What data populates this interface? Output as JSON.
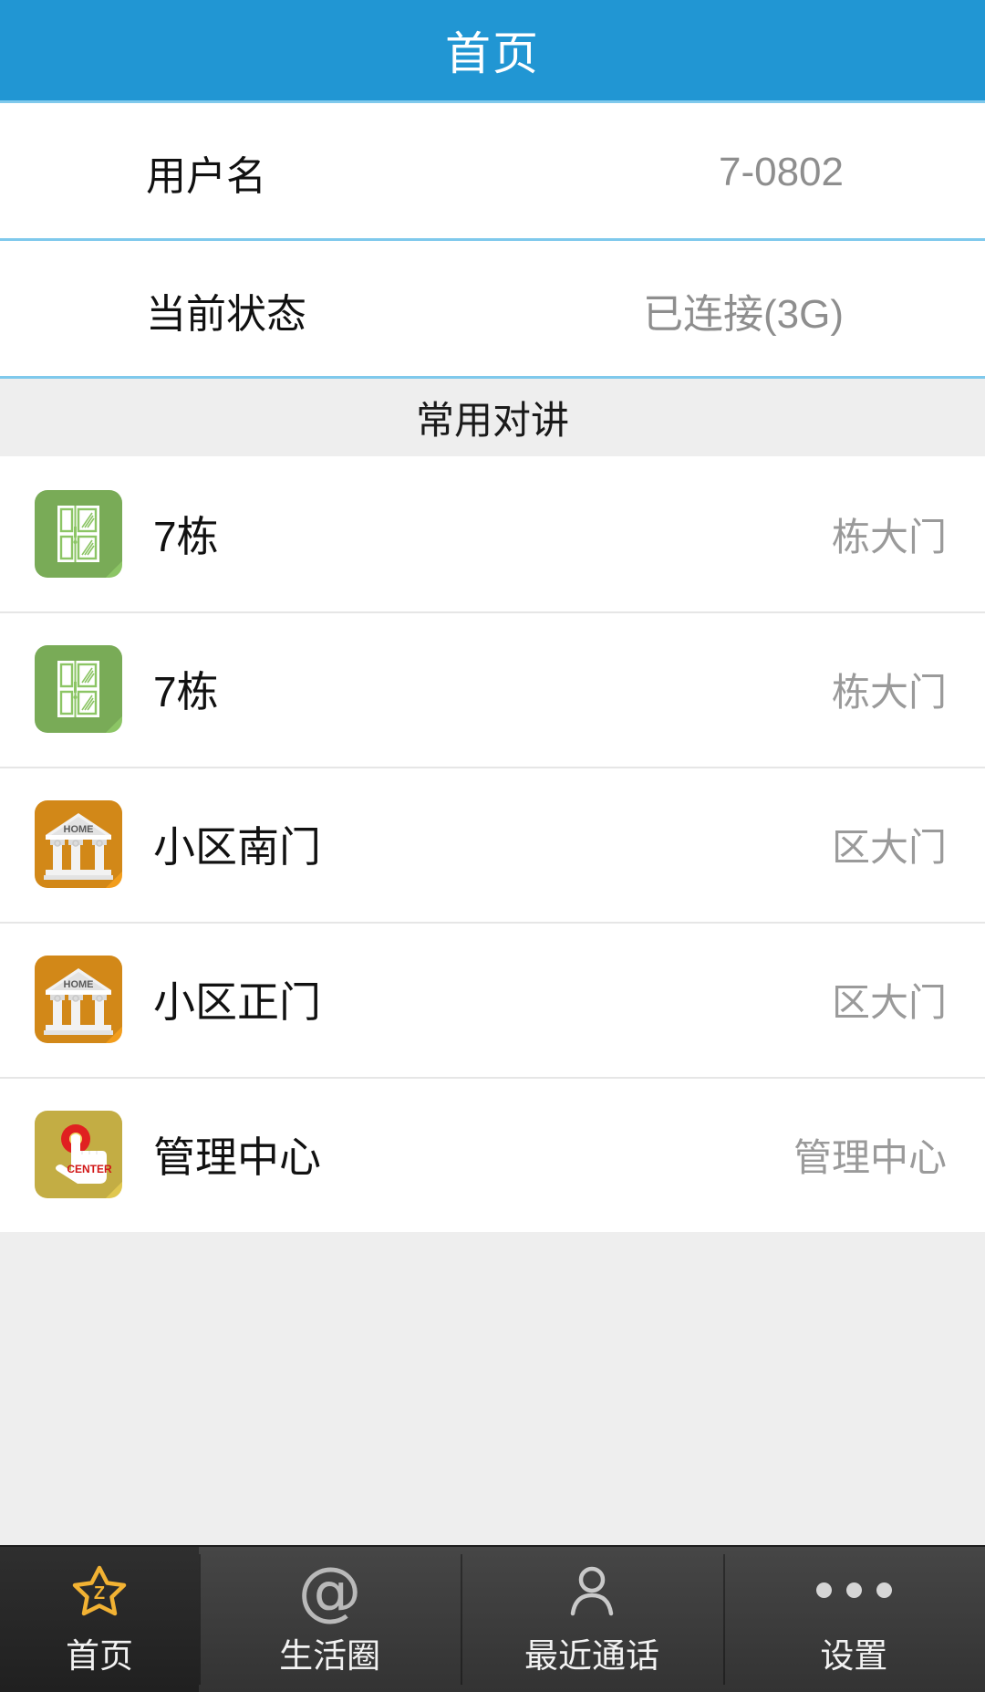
{
  "header": {
    "title": "首页",
    "bg_color": "#2196d3",
    "text_color": "#ffffff"
  },
  "info_rows": [
    {
      "label": "用户名",
      "value": "7-0802"
    },
    {
      "label": "当前状态",
      "value": "已连接(3G)"
    }
  ],
  "section": {
    "title": "常用对讲"
  },
  "list_items": [
    {
      "name": "7栋",
      "type": "栋大门",
      "icon": "door-icon",
      "icon_color": "#8cc565",
      "icon_label": ""
    },
    {
      "name": "7栋",
      "type": "栋大门",
      "icon": "door-icon",
      "icon_color": "#8cc565",
      "icon_label": ""
    },
    {
      "name": "小区南门",
      "type": "区大门",
      "icon": "home-building-icon",
      "icon_color": "#f29d1c",
      "icon_label": "HOME"
    },
    {
      "name": "小区正门",
      "type": "区大门",
      "icon": "home-building-icon",
      "icon_color": "#f29d1c",
      "icon_label": "HOME"
    },
    {
      "name": "管理中心",
      "type": "管理中心",
      "icon": "hand-press-center-icon",
      "icon_color": "#e0c74f",
      "icon_label": "CENTER"
    }
  ],
  "tabbar": {
    "items": [
      {
        "label": "首页",
        "icon": "star-z-icon",
        "active": true
      },
      {
        "label": "生活圈",
        "icon": "at-icon",
        "active": false
      },
      {
        "label": "最近通话",
        "icon": "person-icon",
        "active": false
      },
      {
        "label": "设置",
        "icon": "more-dots-icon",
        "active": false
      }
    ],
    "active_icon_color": "#f2b233",
    "inactive_icon_color": "#bdbdbd"
  }
}
